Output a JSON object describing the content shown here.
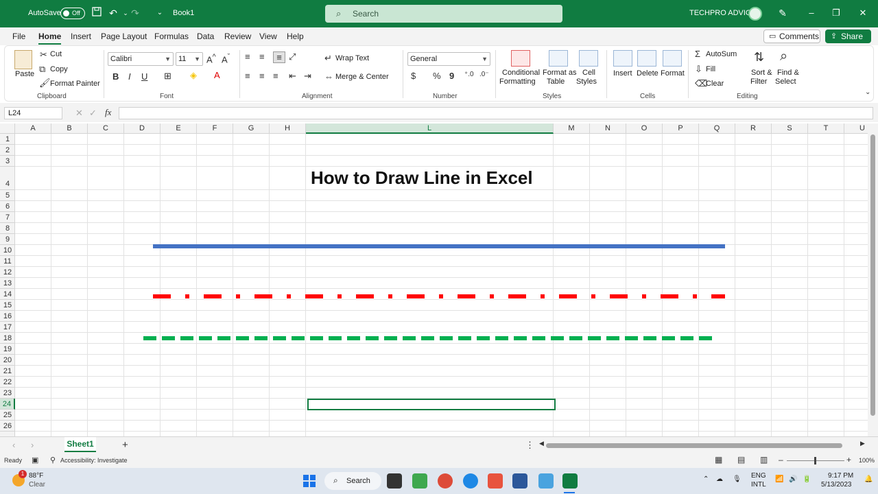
{
  "titlebar": {
    "autosave_label": "AutoSave",
    "autosave_state": "Off",
    "doc_name": "Book1",
    "search_placeholder": "Search",
    "account_name": "TECHPRO ADVICE"
  },
  "tabs": [
    "File",
    "Home",
    "Insert",
    "Page Layout",
    "Formulas",
    "Data",
    "Review",
    "View",
    "Help"
  ],
  "active_tab": "Home",
  "actions": {
    "comments": "Comments",
    "share": "Share"
  },
  "ribbon": {
    "clipboard": {
      "paste": "Paste",
      "cut": "Cut",
      "copy": "Copy",
      "format_painter": "Format Painter",
      "label": "Clipboard"
    },
    "font": {
      "name": "Calibri",
      "size": "11",
      "bold": "B",
      "italic": "I",
      "underline": "U",
      "label": "Font"
    },
    "alignment": {
      "wrap_text": "Wrap Text",
      "merge_center": "Merge & Center",
      "label": "Alignment"
    },
    "number": {
      "format": "General",
      "currency": "$",
      "percent": "%",
      "comma": "9",
      "label": "Number"
    },
    "styles": {
      "conditional_1": "Conditional",
      "conditional_2": "Formatting",
      "format_as_1": "Format as",
      "format_as_2": "Table",
      "cell_1": "Cell",
      "cell_2": "Styles",
      "label": "Styles"
    },
    "cells": {
      "insert": "Insert",
      "delete": "Delete",
      "format": "Format",
      "label": "Cells"
    },
    "editing": {
      "autosum": "AutoSum",
      "fill": "Fill",
      "clear": "Clear",
      "sort_1": "Sort &",
      "sort_2": "Filter",
      "find_1": "Find &",
      "find_2": "Select",
      "label": "Editing"
    }
  },
  "formula_bar": {
    "name_box": "L24",
    "fx": "fx",
    "value": ""
  },
  "columns": [
    "A",
    "B",
    "C",
    "D",
    "E",
    "F",
    "G",
    "H",
    "L",
    "M",
    "N",
    "O",
    "P",
    "Q",
    "R",
    "S",
    "T",
    "U"
  ],
  "selected_column": "L",
  "rows": [
    "1",
    "2",
    "3",
    "4",
    "5",
    "6",
    "7",
    "8",
    "9",
    "10",
    "11",
    "12",
    "13",
    "14",
    "15",
    "16",
    "17",
    "18",
    "19",
    "20",
    "21",
    "22",
    "23",
    "24",
    "25",
    "26"
  ],
  "selected_row": "24",
  "sheet": {
    "title": "How to Draw Line in Excel",
    "lines": [
      {
        "style": "solid",
        "color": "#4472c4"
      },
      {
        "style": "long-dash-dot",
        "color": "#ff0000"
      },
      {
        "style": "dash",
        "color": "#00b050"
      }
    ]
  },
  "sheet_tabs": [
    "Sheet1"
  ],
  "status": {
    "ready": "Ready",
    "accessibility": "Accessibility: Investigate",
    "zoom": "100%"
  },
  "taskbar": {
    "weather_temp": "88°F",
    "weather_desc": "Clear",
    "weather_badge": "1",
    "search": "Search",
    "lang_1": "ENG",
    "lang_2": "INTL",
    "time": "9:17 PM",
    "date": "5/13/2023"
  }
}
